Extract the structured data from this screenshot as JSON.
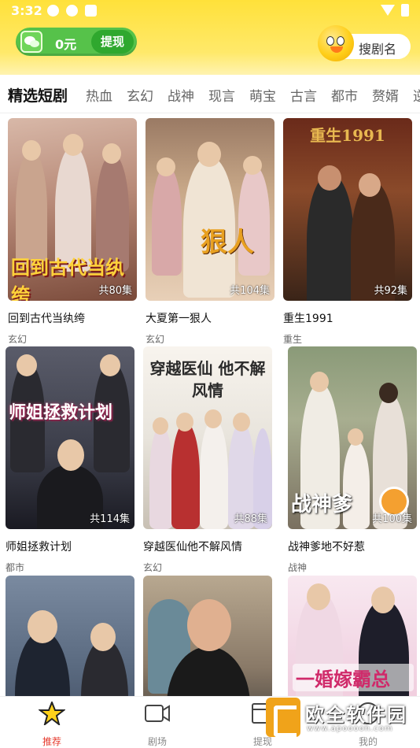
{
  "status_bar": {
    "time": "3:32"
  },
  "header": {
    "wallet_amount": "0元",
    "withdraw_label": "提现",
    "search_label": "搜剧名"
  },
  "tabs": [
    "精选短剧",
    "热血",
    "玄幻",
    "战神",
    "现言",
    "萌宝",
    "古言",
    "都市",
    "赘婿",
    "逆"
  ],
  "dramas": [
    {
      "title": "回到古代当纨绔",
      "genre": "玄幻",
      "episodes": "共80集",
      "poster_text": "回到古代当纨绔"
    },
    {
      "title": "大夏第一狠人",
      "genre": "玄幻",
      "episodes": "共104集",
      "poster_text": "狠人"
    },
    {
      "title": "重生1991",
      "genre": "重生",
      "episodes": "共92集",
      "poster_text": "重生1991"
    },
    {
      "title": "师姐拯救计划",
      "genre": "都市",
      "episodes": "共114集",
      "poster_text": "师姐拯救计划"
    },
    {
      "title": "穿越医仙他不解风情",
      "genre": "玄幻",
      "episodes": "共88集",
      "poster_text": "穿越医仙 他不解风情"
    },
    {
      "title": "战神爹地不好惹",
      "genre": "战神",
      "episodes": "共100集",
      "poster_text": "战神爹"
    },
    {
      "title": "",
      "genre": "",
      "episodes": "",
      "poster_text": ""
    },
    {
      "title": "",
      "genre": "",
      "episodes": "",
      "poster_text": ""
    },
    {
      "title": "",
      "genre": "",
      "episodes": "",
      "poster_text": "一婚嫁霸总"
    }
  ],
  "bottom_nav": [
    {
      "label": "推荐",
      "icon": "star-icon"
    },
    {
      "label": "剧场",
      "icon": "video-camera-icon"
    },
    {
      "label": "提现",
      "icon": "cash-icon"
    },
    {
      "label": "我的",
      "icon": "profile-icon"
    }
  ],
  "watermark": {
    "title": "欧全软件园",
    "subtitle": "www.apooooh.com"
  },
  "colors": {
    "accent_yellow": "#ffe13a",
    "green": "#56c24a",
    "active_tab": "#e63b2e"
  }
}
